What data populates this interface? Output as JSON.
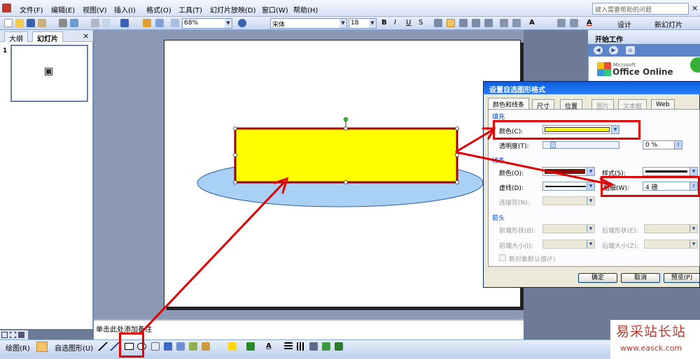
{
  "menubar": {
    "items": [
      "文件(F)",
      "编辑(E)",
      "视图(V)",
      "插入(I)",
      "格式(O)",
      "工具(T)",
      "幻灯片放映(D)",
      "窗口(W)",
      "帮助(H)"
    ],
    "help_placeholder": "键入需要帮助的问题",
    "close_x": "×"
  },
  "toolbar": {
    "zoom": "68%",
    "font": "宋体",
    "font_size": "18",
    "bold": "B",
    "italic": "I",
    "underline": "U",
    "shadow": "S",
    "grow_font": "A",
    "design_label": "设计",
    "new_slide_label": "新幻灯片"
  },
  "outline": {
    "tab_outline": "大纲",
    "tab_slides": "幻灯片",
    "close": "×",
    "slide_number": "1"
  },
  "notes": {
    "placeholder": "单击此处添加备注"
  },
  "taskpane": {
    "title": "开始工作",
    "office_online": "Office Online",
    "microsoft": "Microsoft"
  },
  "dialog": {
    "title": "设置自选图形格式",
    "tabs": [
      "颜色和线条",
      "尺寸",
      "位置",
      "图片",
      "文本框",
      "Web"
    ],
    "fill_section": "填充",
    "color_label": "颜色(C):",
    "transparency_label": "透明度(T):",
    "transparency_value": "0 %",
    "line_section": "线条",
    "line_color_label": "颜色(O):",
    "line_style_label": "样式(S):",
    "dash_label": "虚线(D):",
    "weight_label": "粗细(W):",
    "weight_value": "4 磅",
    "connector_label": "连接符(N):",
    "arrows_section": "箭头",
    "begin_style_label": "前端形状(B):",
    "end_style_label": "后端形状(E):",
    "begin_size_label": "前端大小(I):",
    "end_size_label": "后端大小(Z):",
    "default_checkbox": "新对象默认值(F)",
    "ok": "确定",
    "cancel": "取消",
    "preview": "预览(P)"
  },
  "drawbar": {
    "draw_label": "绘图(R)",
    "autoshapes_label": "自选图形(U)"
  },
  "watermark": {
    "title": "易采站长站",
    "url": "www.easck.com"
  },
  "colors": {
    "fill_yellow": "#ffff00",
    "line_red": "#a00000",
    "ellipse_blue": "#a9d0f5",
    "annotation_red": "#e00000"
  }
}
